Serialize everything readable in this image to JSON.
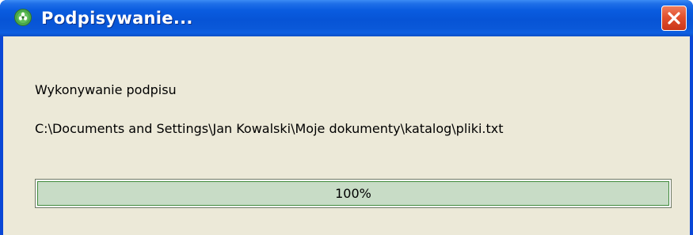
{
  "window": {
    "title": "Podpisywanie...",
    "app_icon": "green-flower-icon",
    "close_icon": "close-icon"
  },
  "dialog": {
    "operation_label": "Wykonywanie podpisu",
    "file_path": "C:\\Documents and Settings\\Jan Kowalski\\Moje dokumenty\\katalog\\pliki.txt"
  },
  "progress": {
    "value": 1.0,
    "label": "100%"
  },
  "colors": {
    "titlebar": "#0a58d8",
    "client_background": "#ece9d8",
    "progress_fill": "#c8dcc6",
    "progress_border": "#3f8a3a",
    "close_button": "#e2502d"
  }
}
